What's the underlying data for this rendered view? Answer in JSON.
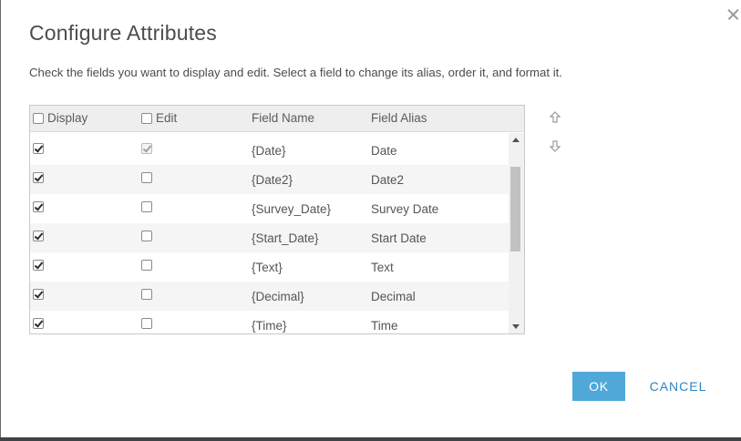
{
  "dialog": {
    "title": "Configure Attributes",
    "instructions": "Check the fields you want to display and edit. Select a field to change its alias, order it, and format it."
  },
  "grid": {
    "columns": {
      "display": "Display",
      "edit": "Edit",
      "field_name": "Field Name",
      "field_alias": "Field Alias"
    },
    "header_display_checked": false,
    "header_edit_checked": false,
    "rows": [
      {
        "display": true,
        "edit": true,
        "edit_disabled": true,
        "field_name": "{Date}",
        "field_alias": "Date"
      },
      {
        "display": true,
        "edit": false,
        "edit_disabled": false,
        "field_name": "{Date2}",
        "field_alias": "Date2"
      },
      {
        "display": true,
        "edit": false,
        "edit_disabled": false,
        "field_name": "{Survey_Date}",
        "field_alias": "Survey Date"
      },
      {
        "display": true,
        "edit": false,
        "edit_disabled": false,
        "field_name": "{Start_Date}",
        "field_alias": "Start Date"
      },
      {
        "display": true,
        "edit": false,
        "edit_disabled": false,
        "field_name": "{Text}",
        "field_alias": "Text"
      },
      {
        "display": true,
        "edit": false,
        "edit_disabled": false,
        "field_name": "{Decimal}",
        "field_alias": "Decimal"
      },
      {
        "display": true,
        "edit": false,
        "edit_disabled": false,
        "field_name": "{Time}",
        "field_alias": "Time"
      }
    ]
  },
  "buttons": {
    "ok": "OK",
    "cancel": "CANCEL"
  },
  "icons": {
    "close": "close-icon",
    "move_up": "arrow-up-icon",
    "move_down": "arrow-down-icon"
  },
  "colors": {
    "accent": "#4fa8d8",
    "link": "#2f86c1"
  }
}
